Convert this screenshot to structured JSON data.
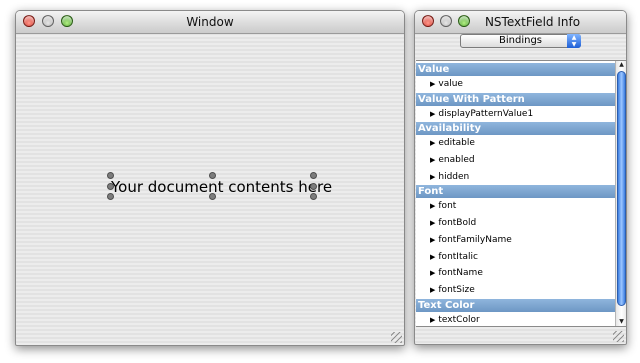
{
  "doc_window": {
    "title": "Window",
    "content_text": "Your document contents here"
  },
  "info_window": {
    "title": "NSTextField Info",
    "pane_popup": {
      "selected": "Bindings"
    },
    "sections": [
      {
        "header": "Value",
        "items": [
          "value"
        ]
      },
      {
        "header": "Value With Pattern",
        "items": [
          "displayPatternValue1"
        ]
      },
      {
        "header": "Availability",
        "items": [
          "editable",
          "enabled",
          "hidden"
        ]
      },
      {
        "header": "Font",
        "items": [
          "font",
          "fontBold",
          "fontFamilyName",
          "fontItalic",
          "fontName",
          "fontSize"
        ]
      },
      {
        "header": "Text Color",
        "items": [
          "textColor"
        ]
      }
    ]
  },
  "icons": {
    "close": "close-icon",
    "minimize": "minimize-icon",
    "zoom": "zoom-icon",
    "disclosure": "disclosure-triangle-icon"
  },
  "colors": {
    "section_header": "#7aa3d0",
    "scroll_thumb": "#3b7de0",
    "close_button": "#d3261a",
    "zoom_button": "#3f9d1b"
  },
  "glyphs": {
    "disclosure": "▶",
    "popup_up": "▲",
    "popup_down": "▼",
    "scroll_up": "▲",
    "scroll_down": "▼"
  }
}
